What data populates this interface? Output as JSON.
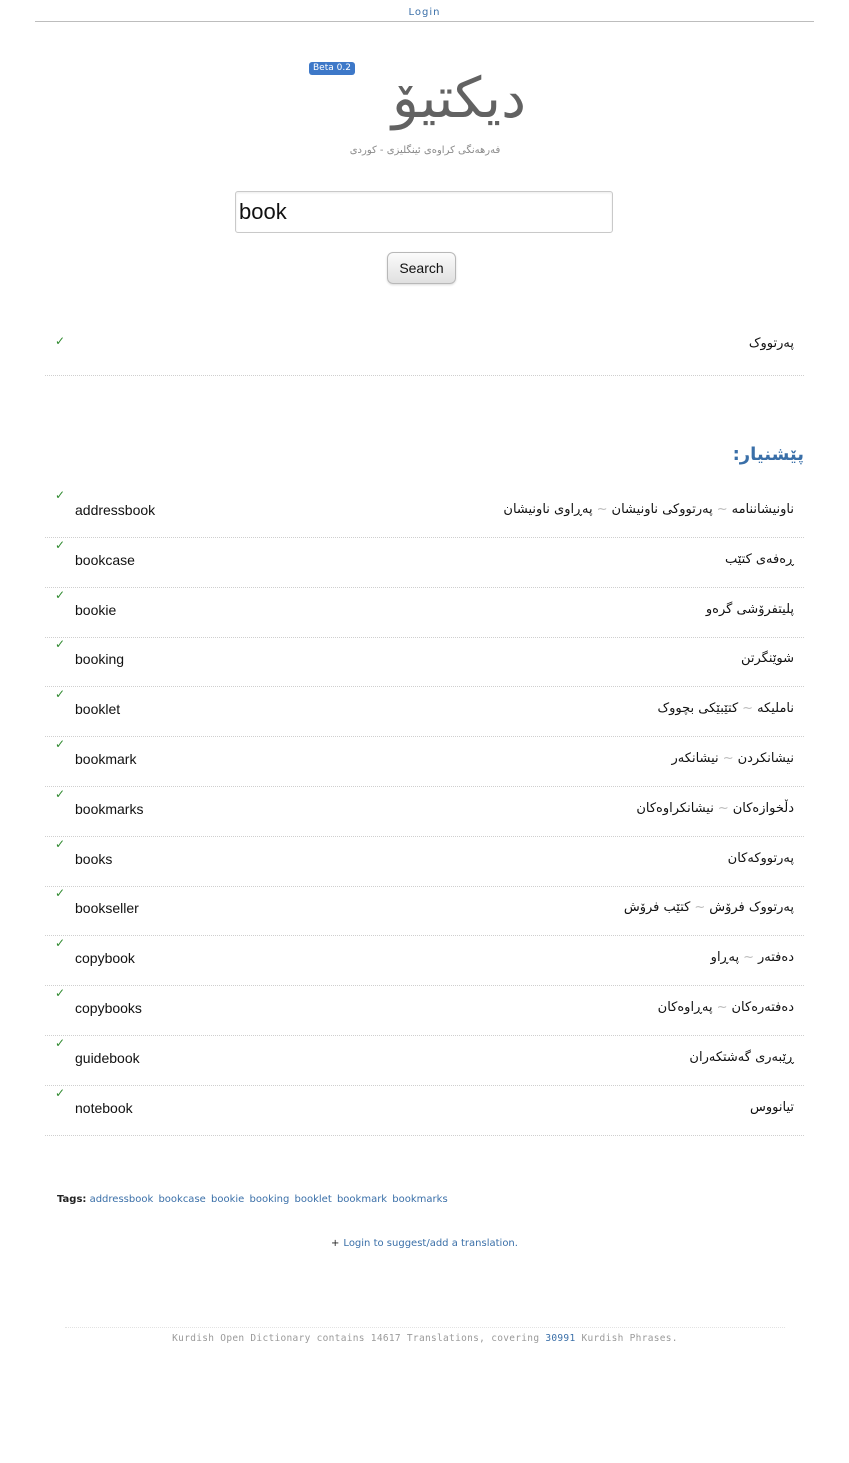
{
  "topbar": {
    "login_label": "Login"
  },
  "logo": {
    "beta_label": "Beta 0.2",
    "title": "دیکتیۆ",
    "tagline": "فەرهەنگی کراوەی ئینگلیزی - کوردی"
  },
  "search": {
    "value": "book",
    "button_label": "Search"
  },
  "main_result": {
    "check": "✓",
    "kurdish": "پەرتووک"
  },
  "suggestions": {
    "title": "پێشنیار:",
    "items": [
      {
        "english": "addressbook",
        "kurdish": [
          "ناونیشاننامە",
          "پەرتووکی ناونیشان",
          "پەڕاوی ناونیشان"
        ]
      },
      {
        "english": "bookcase",
        "kurdish": [
          "ڕەفەی کتێب"
        ]
      },
      {
        "english": "bookie",
        "kurdish": [
          "پلیتفرۆشی گرەو"
        ]
      },
      {
        "english": "booking",
        "kurdish": [
          "شوێنگرتن"
        ]
      },
      {
        "english": "booklet",
        "kurdish": [
          "ناملیکە",
          "کتێبێکی بچووک"
        ]
      },
      {
        "english": "bookmark",
        "kurdish": [
          "نیشانکردن",
          "نیشانکەر"
        ]
      },
      {
        "english": "bookmarks",
        "kurdish": [
          "دڵخوازەکان",
          "نیشانکراوەکان"
        ]
      },
      {
        "english": "books",
        "kurdish": [
          "پەرتووکەکان"
        ]
      },
      {
        "english": "bookseller",
        "kurdish": [
          "پەرتووک فرۆش",
          "کتێب فرۆش"
        ]
      },
      {
        "english": "copybook",
        "kurdish": [
          "دەفتەر",
          "پەڕاو"
        ]
      },
      {
        "english": "copybooks",
        "kurdish": [
          "دەفتەرەکان",
          "پەڕاوەکان"
        ]
      },
      {
        "english": "guidebook",
        "kurdish": [
          "ڕێبەری گەشتکەران"
        ]
      },
      {
        "english": "notebook",
        "kurdish": [
          "تیانووس"
        ]
      }
    ]
  },
  "tags": {
    "label": "Tags:",
    "items": [
      "addressbook",
      "bookcase",
      "bookie",
      "booking",
      "booklet",
      "bookmark",
      "bookmarks"
    ]
  },
  "add_translation": {
    "plus": "+",
    "link_label": "Login to suggest/add a translation."
  },
  "footer": {
    "text_before": "Kurdish Open Dictionary contains 14617 Translations, covering ",
    "phrases_count": "30991",
    "text_after": " Kurdish Phrases."
  }
}
